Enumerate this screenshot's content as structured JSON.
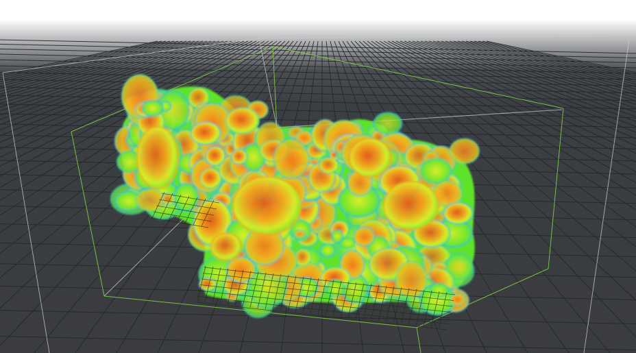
{
  "viewport": {
    "view": "perspective",
    "background_top": "#ffffff",
    "background_bottom": "#3a3c3f"
  },
  "ground_grid": {
    "line_color": "#23262a",
    "visible": true
  },
  "bounding_box": {
    "outer_color": "#c9ccc8",
    "inner_color": "#7fcf45"
  },
  "volume": {
    "shading": "heat-map",
    "colors": {
      "hot": "#e0561e",
      "warm": "#f2a21d",
      "mid": "#d9f02a",
      "green": "#5fe22a",
      "cool": "#2fd3a0",
      "cold": "#21b7d6"
    }
  }
}
